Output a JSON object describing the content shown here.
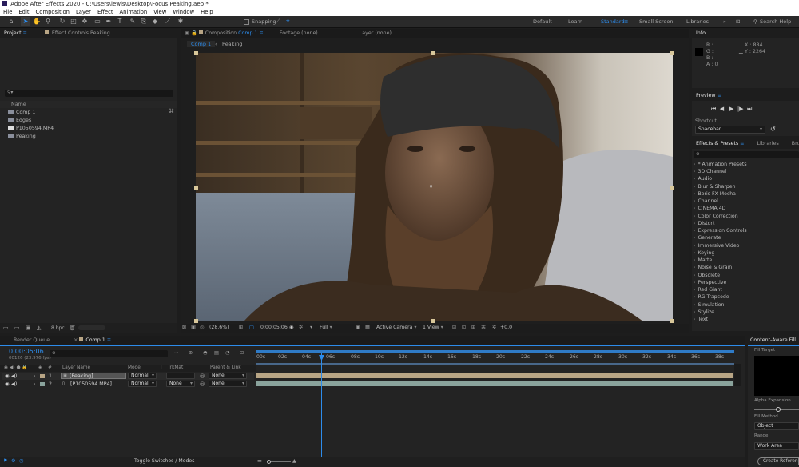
{
  "window_title": "Adobe After Effects 2020 - C:\\Users\\lewis\\Desktop\\Focus Peaking.aep *",
  "menu": [
    "File",
    "Edit",
    "Composition",
    "Layer",
    "Effect",
    "Animation",
    "View",
    "Window",
    "Help"
  ],
  "toolbar": {
    "snapping_label": "Snapping"
  },
  "workspaces": {
    "default": "Default",
    "learn": "Learn",
    "standard": "Standard",
    "small_screen": "Small Screen",
    "libraries": "Libraries",
    "search_help": "Search Help"
  },
  "project_panel": {
    "tabs": [
      "Project",
      "Effect Controls Peaking"
    ],
    "column_name": "Name",
    "items": [
      {
        "name": "Comp 1",
        "type": "comp"
      },
      {
        "name": "Edges",
        "type": "folder"
      },
      {
        "name": "P1050594.MP4",
        "type": "footage"
      },
      {
        "name": "Peaking",
        "type": "comp"
      }
    ],
    "bpc": "8 bpc"
  },
  "viewer": {
    "tabs": {
      "composition": "Composition",
      "comp_name": "Comp 1",
      "footage": "Footage (none)",
      "layer": "Layer (none)"
    },
    "breadcrumbs": [
      "Comp 1",
      "Peaking"
    ],
    "bottom": {
      "zoom": "(28.6%)",
      "time": "0:00:05:06",
      "resolution": "Full",
      "camera": "Active Camera",
      "view": "1 View",
      "exposure": "+0.0"
    }
  },
  "info_panel": {
    "title": "Info",
    "r": "R :",
    "g": "G :",
    "b": "B :",
    "a": "A :",
    "a_value": "0",
    "x": "X : 884",
    "y": "Y : 2264"
  },
  "preview_panel": {
    "title": "Preview",
    "shortcut_label": "Shortcut",
    "shortcut_value": "Spacebar"
  },
  "effects_panel": {
    "tabs": [
      "Effects & Presets",
      "Libraries",
      "Brush"
    ],
    "items": [
      "* Animation Presets",
      "3D Channel",
      "Audio",
      "Blur & Sharpen",
      "Boris FX Mocha",
      "Channel",
      "CINEMA 4D",
      "Color Correction",
      "Distort",
      "Expression Controls",
      "Generate",
      "Immersive Video",
      "Keying",
      "Matte",
      "Noise & Grain",
      "Obsolete",
      "Perspective",
      "Red Giant",
      "RG Trapcode",
      "Simulation",
      "Stylize",
      "Text"
    ]
  },
  "timeline": {
    "tabs": [
      "Render Queue",
      "Comp 1"
    ],
    "timecode": "0:00:05:06",
    "frame_info": "00126 (23.976 fps)",
    "headers": {
      "layer_name": "Layer Name",
      "mode": "Mode",
      "t": "T",
      "trkmat": "TrkMat",
      "parent": "Parent & Link"
    },
    "layers": [
      {
        "num": "1",
        "name": "[Peaking]",
        "mode": "Normal",
        "trkmat": "",
        "parent": "None",
        "bar_color": "#b8a585"
      },
      {
        "num": "2",
        "name": "[P1050594.MP4]",
        "mode": "Normal",
        "trkmat": "None",
        "parent": "None",
        "bar_color": "#8aa39c"
      }
    ],
    "ruler": [
      "00s",
      "02s",
      "04s",
      "06s",
      "08s",
      "10s",
      "12s",
      "14s",
      "16s",
      "18s",
      "20s",
      "22s",
      "24s",
      "26s",
      "28s",
      "30s",
      "32s",
      "34s",
      "36s",
      "38s"
    ],
    "toggle_label": "Toggle Switches / Modes"
  },
  "content_aware": {
    "title": "Content-Aware Fill",
    "fill_target": "Fill Target",
    "alpha_expansion": "Alpha Expansion",
    "fill_method": "Fill Method",
    "fill_method_value": "Object",
    "range": "Range",
    "range_value": "Work Area",
    "create_button": "Create Reference Frame"
  },
  "colors": {
    "accent": "#2d8ceb",
    "layer1": "#b8a585",
    "layer2": "#8aa39c"
  }
}
